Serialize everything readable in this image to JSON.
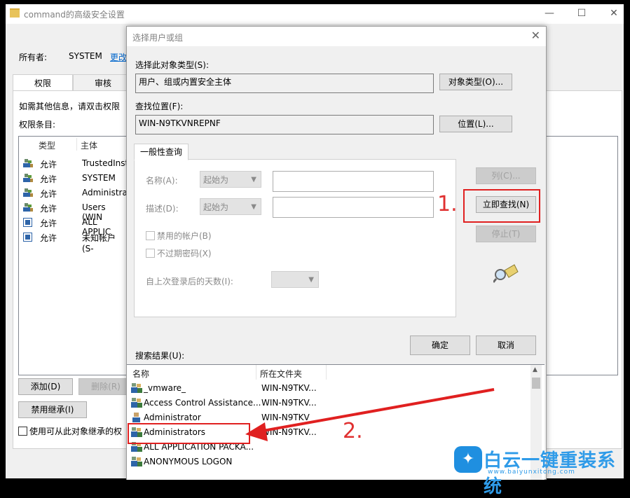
{
  "background_window": {
    "title": "command的高级安全设置",
    "owner_label": "所有者:",
    "owner_value": "SYSTEM",
    "owner_change_link": "更改",
    "tabs": [
      "权限",
      "审核"
    ],
    "info_text": "如需其他信息，请双击权限",
    "entries_label": "权限条目:",
    "columns": [
      "类型",
      "主体"
    ],
    "entries": [
      {
        "type": "允许",
        "principal": "TrustedInst",
        "icon": "group-icon"
      },
      {
        "type": "允许",
        "principal": "SYSTEM",
        "icon": "group-icon"
      },
      {
        "type": "允许",
        "principal": "Administrat",
        "icon": "group-icon"
      },
      {
        "type": "允许",
        "principal": "Users (WIN",
        "icon": "group-icon"
      },
      {
        "type": "允许",
        "principal": "ALL APPLIC",
        "icon": "app-package-icon"
      },
      {
        "type": "允许",
        "principal": "未知帐户(S-",
        "icon": "app-package-icon"
      }
    ],
    "add_button": "添加(D)",
    "remove_button": "删除(R)",
    "disable_inheritance_button": "禁用继承(I)",
    "inherit_checkbox_label": "使用可从此对象继承的权"
  },
  "dialog": {
    "title": "选择用户或组",
    "object_type_label": "选择此对象类型(S):",
    "object_type_value": "用户、组或内置安全主体",
    "object_type_button": "对象类型(O)...",
    "location_label": "查找位置(F):",
    "location_value": "WIN-N9TKVNREPNF",
    "location_button": "位置(L)...",
    "general_tab": "一般性查询",
    "name_label": "名称(A):",
    "name_combo": "起始为",
    "desc_label": "描述(D):",
    "desc_combo": "起始为",
    "disabled_accounts": "禁用的帐户(B)",
    "non_expiring": "不过期密码(X)",
    "days_label": "自上次登录后的天数(I):",
    "columns_button": "列(C)...",
    "find_now_button": "立即查找(N)",
    "stop_button": "停止(T)",
    "ok_button": "确定",
    "cancel_button": "取消",
    "results_label": "搜索结果(U):",
    "results_columns": [
      "名称",
      "所在文件夹"
    ],
    "results": [
      {
        "name": "_vmware_",
        "folder": "WIN-N9TKV...",
        "icon": "group-icon"
      },
      {
        "name": "Access Control Assistance...",
        "folder": "WIN-N9TKV...",
        "icon": "group-icon"
      },
      {
        "name": "Administrator",
        "folder": "WIN-N9TKV",
        "icon": "user-icon"
      },
      {
        "name": "Administrators",
        "folder": "WIN-N9TKV...",
        "icon": "group-icon"
      },
      {
        "name": "ALL APPLICATION PACKA...",
        "folder": "",
        "icon": "group-icon"
      },
      {
        "name": "ANONYMOUS LOGON",
        "folder": "",
        "icon": "group-icon"
      }
    ]
  },
  "annotations": {
    "step1": "1.",
    "step2": "2.",
    "color": "#e02020"
  },
  "watermark": {
    "text": "白云一键重装系统",
    "url": "www.baiyunxitong.com"
  }
}
